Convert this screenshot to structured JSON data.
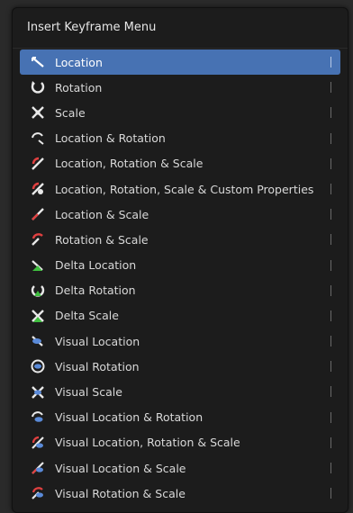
{
  "menu": {
    "title": "Insert Keyframe Menu",
    "items": [
      {
        "label": "Location",
        "icon": "location-icon"
      },
      {
        "label": "Rotation",
        "icon": "rotation-icon"
      },
      {
        "label": "Scale",
        "icon": "scale-icon"
      },
      {
        "label": "Location & Rotation",
        "icon": "location-rotation-icon"
      },
      {
        "label": "Location, Rotation & Scale",
        "icon": "location-rotation-scale-icon"
      },
      {
        "label": "Location, Rotation, Scale & Custom Properties",
        "icon": "custom-properties-icon"
      },
      {
        "label": "Location & Scale",
        "icon": "location-scale-icon"
      },
      {
        "label": "Rotation & Scale",
        "icon": "rotation-scale-icon"
      },
      {
        "label": "Delta Location",
        "icon": "delta-location-icon"
      },
      {
        "label": "Delta Rotation",
        "icon": "delta-rotation-icon"
      },
      {
        "label": "Delta Scale",
        "icon": "delta-scale-icon"
      },
      {
        "label": "Visual Location",
        "icon": "visual-location-icon"
      },
      {
        "label": "Visual Rotation",
        "icon": "visual-rotation-icon"
      },
      {
        "label": "Visual Scale",
        "icon": "visual-scale-icon"
      },
      {
        "label": "Visual Location & Rotation",
        "icon": "visual-location-rotation-icon"
      },
      {
        "label": "Visual Location, Rotation & Scale",
        "icon": "visual-location-rotation-scale-icon"
      },
      {
        "label": "Visual Location & Scale",
        "icon": "visual-location-scale-icon"
      },
      {
        "label": "Visual Rotation & Scale",
        "icon": "visual-rotation-scale-icon"
      }
    ],
    "active_index": 0,
    "colors": {
      "highlight": "#4772b3",
      "background": "#1c1c1c",
      "text": "#d8d8d8"
    }
  }
}
